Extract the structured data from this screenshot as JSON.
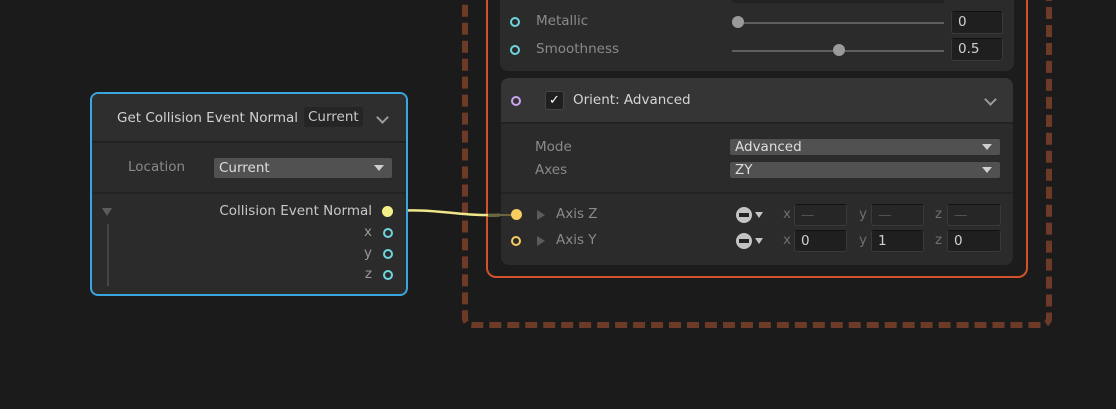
{
  "node": {
    "title": "Get Collision Event Normal",
    "title_badge": "Current",
    "location_label": "Location",
    "location_value": "Current",
    "output_label": "Collision Event Normal",
    "outputs": [
      "x",
      "y",
      "z"
    ]
  },
  "context": {
    "metallic_label": "Metallic",
    "metallic_value": "0",
    "metallic_fraction": 0,
    "smoothness_label": "Smoothness",
    "smoothness_value": "0.5",
    "smoothness_fraction": 0.5,
    "block": {
      "title": "Orient: Advanced",
      "enabled": true,
      "mode_label": "Mode",
      "mode_value": "Advanced",
      "axes_label": "Axes",
      "axes_value": "ZY",
      "axis_z": {
        "label": "Axis Z",
        "x": "—",
        "y": "—",
        "z": "—"
      },
      "axis_y": {
        "label": "Axis Y",
        "x": "0",
        "y": "1",
        "z": "0"
      },
      "comp_labels": [
        "x",
        "y",
        "z"
      ]
    }
  },
  "colors": {
    "node_border": "#3aa6e0",
    "context_border": "#d0532b",
    "group_dash": "#6e3a28",
    "wire": "#f0e68c"
  }
}
